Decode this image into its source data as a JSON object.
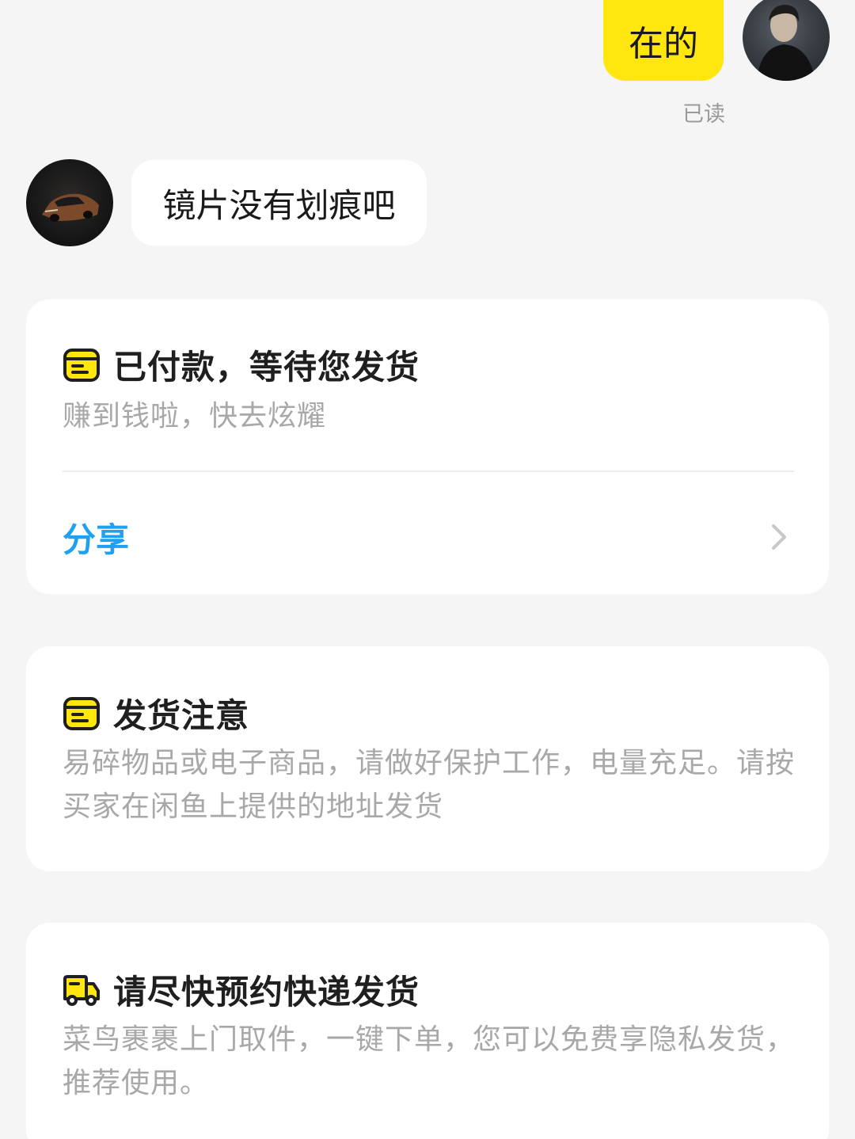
{
  "chat": {
    "outgoing_message": "在的",
    "read_status": "已读",
    "incoming_message": "镜片没有划痕吧"
  },
  "cards": {
    "paid": {
      "title": "已付款，等待您发货",
      "subtitle": "赚到钱啦，快去炫耀",
      "action": "分享",
      "icon": "order-box-icon"
    },
    "shipping_notice": {
      "title": "发货注意",
      "body": "易碎物品或电子商品，请做好保护工作，电量充足。请按买家在闲鱼上提供的地址发货",
      "icon": "order-box-icon"
    },
    "courier": {
      "title": "请尽快预约快递发货",
      "body": "菜鸟裹裹上门取件，一键下单，您可以免费享隐私发货，推荐使用。",
      "icon": "truck-icon"
    }
  },
  "colors": {
    "accent_yellow": "#ffe60f",
    "link_blue": "#1ea1f1",
    "background": "#f5f5f5"
  }
}
